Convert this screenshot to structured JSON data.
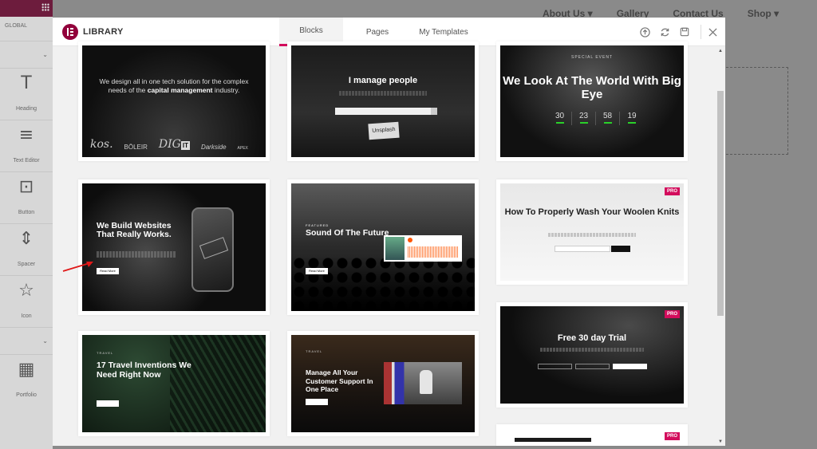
{
  "editor": {
    "global_label": "GLOBAL",
    "widgets": [
      {
        "icon": "heading-icon",
        "glyph": "T",
        "label": "Heading"
      },
      {
        "icon": "text-editor-icon",
        "glyph": "≡",
        "label": "Text Editor"
      },
      {
        "icon": "button-icon",
        "glyph": "⊡",
        "label": "Button"
      },
      {
        "icon": "spacer-icon",
        "glyph": "⇕",
        "label": "Spacer"
      },
      {
        "icon": "icon-widget-icon",
        "glyph": "☆",
        "label": "Icon"
      },
      {
        "icon": "portfolio-icon",
        "glyph": "▦",
        "label": "Portfolio"
      }
    ]
  },
  "site_nav": {
    "items": [
      "About Us ▾",
      "Gallery",
      "Contact Us",
      "Shop ▾"
    ]
  },
  "modal": {
    "title": "LIBRARY",
    "tabs": [
      {
        "label": "Blocks",
        "active": true
      },
      {
        "label": "Pages",
        "active": false
      },
      {
        "label": "My Templates",
        "active": false
      }
    ],
    "header_icons": [
      "upload-icon",
      "sync-icon",
      "save-icon",
      "close-icon"
    ],
    "pro_badge": "PRO"
  },
  "blocks": {
    "b1": {
      "line1": "We design all in one tech solution for the complex",
      "line2_pre": "needs of the ",
      "line2_bold": "capital management",
      "line2_post": " industry.",
      "logos": [
        "kos.",
        "BÖLEIR",
        "DIG",
        "IT",
        "Darkside",
        "APEX"
      ]
    },
    "b2": {
      "heading": "I manage people",
      "tag": "Unsplash"
    },
    "b3": {
      "eyebrow": "SPECIAL EVENT",
      "heading": "We Look At The World With Big Eye",
      "countdown": [
        "30",
        "23",
        "58",
        "19"
      ]
    },
    "b4": {
      "heading": "We Build Websites That Really Works.",
      "button": "Read More"
    },
    "b5": {
      "eyebrow": "FEATURED",
      "heading": "Sound Of The Future",
      "button": "Read More"
    },
    "b6": {
      "heading": "How To Properly Wash Your Woolen Knits",
      "pro": true
    },
    "b7": {
      "heading": "Free 30 day Trial",
      "pro": true
    },
    "b8": {
      "eyebrow": "TRAVEL",
      "heading": "17 Travel Inventions We Need Right Now",
      "button": "Read More"
    },
    "b9": {
      "eyebrow": "TRAVEL",
      "heading": "Manage All Your Customer Support In One Place",
      "button": "Read More"
    },
    "b10": {
      "pro": true
    }
  },
  "colors": {
    "accent": "#d30c5c",
    "editor_brand": "#92003b",
    "arrow": "#e01818"
  }
}
